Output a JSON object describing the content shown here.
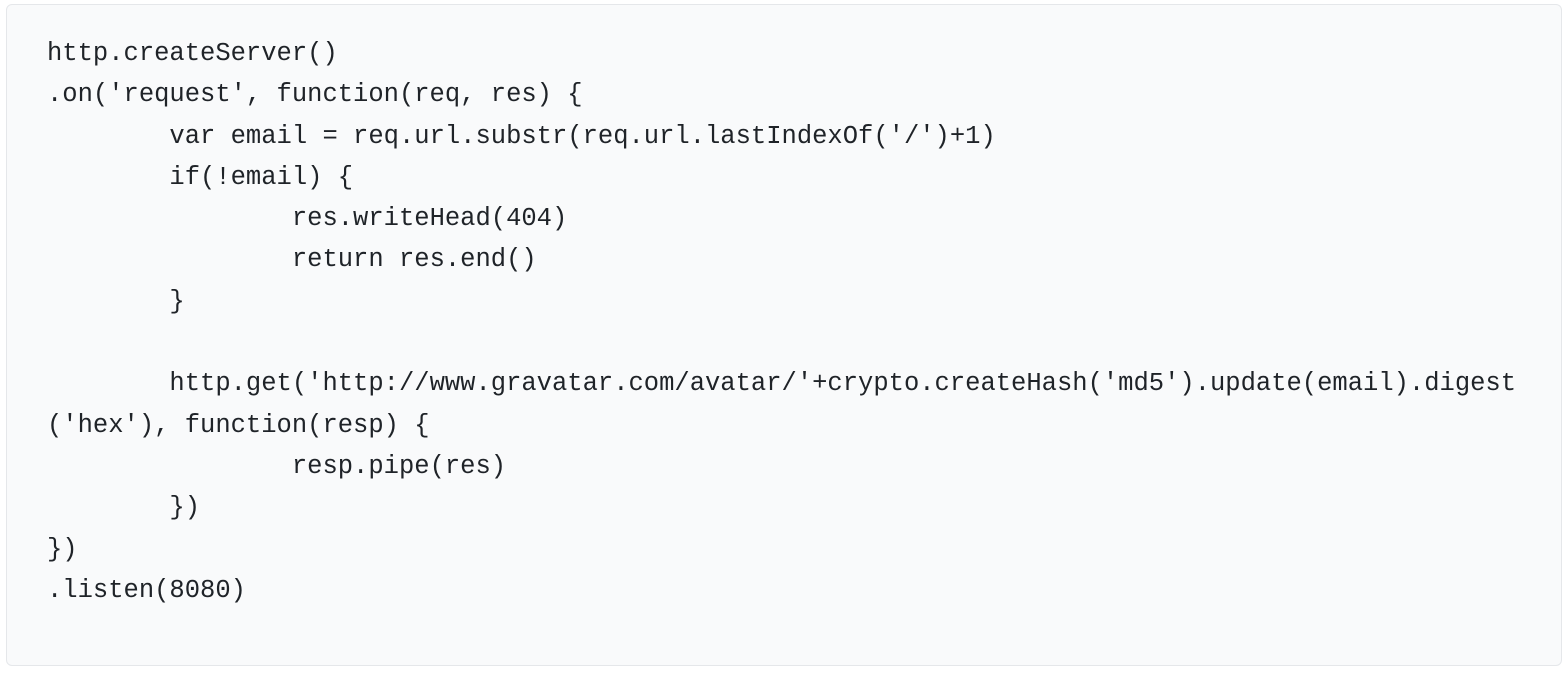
{
  "code": "http.createServer()\n.on('request', function(req, res) {\n        var email = req.url.substr(req.url.lastIndexOf('/')+1)\n        if(!email) {\n                res.writeHead(404)\n                return res.end()\n        }\n\n        http.get('http://www.gravatar.com/avatar/'+crypto.createHash('md5').update(email).digest('hex'), function(resp) {\n                resp.pipe(res)\n        })\n})\n.listen(8080)"
}
